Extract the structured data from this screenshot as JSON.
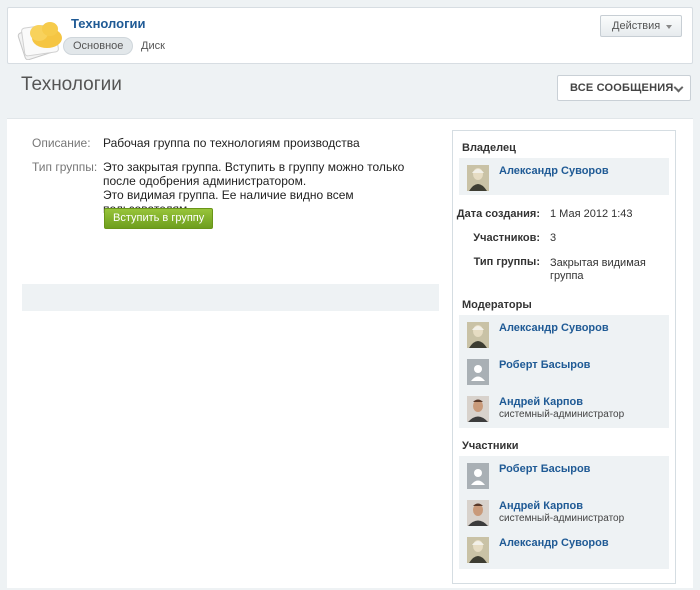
{
  "header": {
    "group_title": "Технологии",
    "tabs": [
      {
        "label": "Основное",
        "active": true
      },
      {
        "label": "Диск",
        "active": false
      }
    ],
    "actions_label": "Действия",
    "actions_icon": "caret-down-icon"
  },
  "page": {
    "title": "Технологии",
    "all_messages_label": "ВСЕ СООБЩЕНИЯ",
    "all_messages_icon": "chevron-down-icon"
  },
  "info": {
    "description_label": "Описание:",
    "description_value": "Рабочая группа по технологиям производства",
    "type_label": "Тип группы:",
    "type_line1": "Это закрытая группа. Вступить в группу можно только после одобрения администратором.",
    "type_line2": "Это видимая группа. Ее наличие видно всем пользователям.",
    "join_label": "Вступить в группу"
  },
  "sidebar": {
    "owner_heading": "Владелец",
    "owner": {
      "name": "Александр Суворов",
      "role": ""
    },
    "stats": [
      {
        "label": "Дата создания:",
        "value": "1 Мая 2012 1:43"
      },
      {
        "label": "Участников:",
        "value": "3"
      },
      {
        "label": "Тип группы:",
        "value": "Закрытая видимая группа"
      }
    ],
    "moderators_heading": "Модераторы",
    "moderators": [
      {
        "name": "Александр Суворов",
        "role": "",
        "avatar": "portrait"
      },
      {
        "name": "Роберт Басыров",
        "role": "",
        "avatar": "ghost"
      },
      {
        "name": "Андрей Карпов",
        "role": "системный-администратор",
        "avatar": "photo"
      }
    ],
    "members_heading": "Участники",
    "members": [
      {
        "name": "Роберт Басыров",
        "role": "",
        "avatar": "ghost"
      },
      {
        "name": "Андрей Карпов",
        "role": "системный-администратор",
        "avatar": "photo"
      },
      {
        "name": "Александр Суворов",
        "role": "",
        "avatar": "portrait"
      }
    ]
  },
  "colors": {
    "link": "#1f5a95",
    "join_button": "#7fae27",
    "panel_bg": "#eef2f4"
  }
}
